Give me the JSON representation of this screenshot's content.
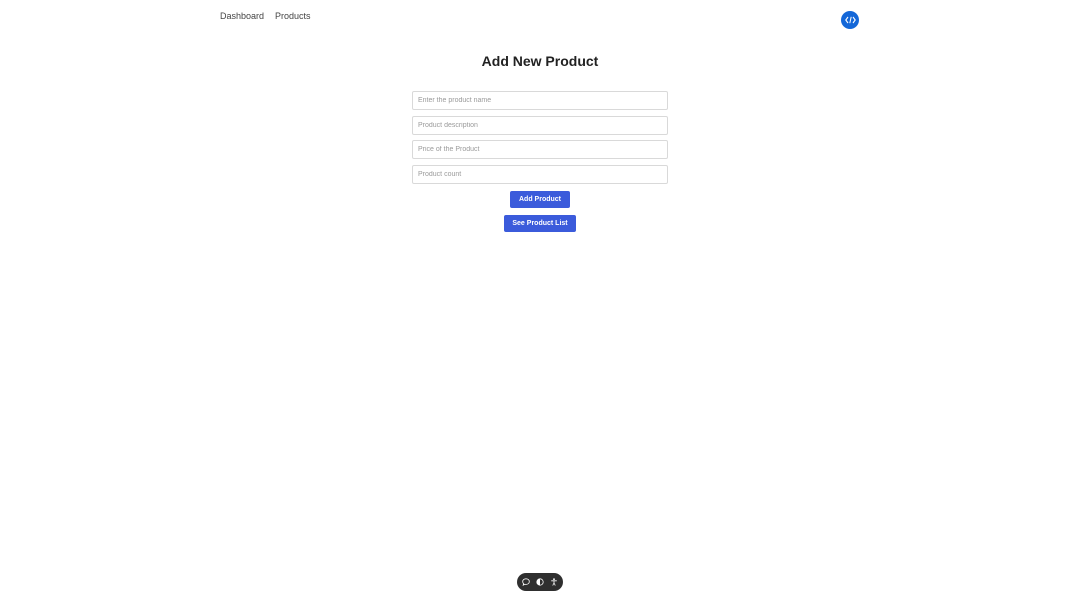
{
  "nav": {
    "items": [
      {
        "label": "Dashboard"
      },
      {
        "label": "Products"
      }
    ],
    "badge_icon": "code-icon"
  },
  "form": {
    "title": "Add New Product",
    "fields": [
      {
        "placeholder": "Enter the product name",
        "value": ""
      },
      {
        "placeholder": "Product description",
        "value": ""
      },
      {
        "placeholder": "Price of the Product",
        "value": ""
      },
      {
        "placeholder": "Product count",
        "value": ""
      }
    ],
    "add_button_label": "Add Product",
    "list_button_label": "See Product List"
  },
  "toolbar": {
    "icons": [
      "comment-icon",
      "eye-icon",
      "accessibility-icon"
    ]
  },
  "colors": {
    "accent": "#3b5bdb",
    "badge": "#1467d8",
    "toolbar": "#2f2f2f"
  }
}
